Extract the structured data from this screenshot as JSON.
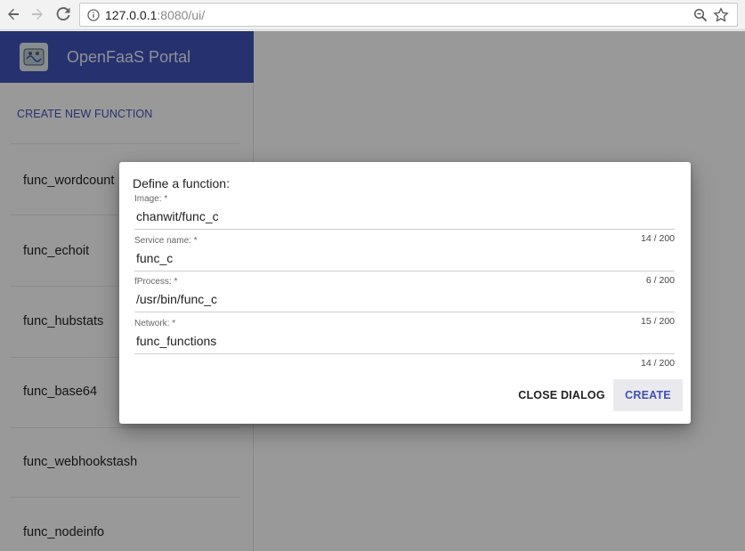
{
  "browser": {
    "url_host": "127.0.0.1",
    "url_rest": ":8080/ui/"
  },
  "sidebar": {
    "app_title": "OpenFaaS Portal",
    "create_label": "CREATE NEW FUNCTION",
    "functions": [
      "func_wordcount",
      "func_echoit",
      "func_hubstats",
      "func_base64",
      "func_webhookstash",
      "func_nodeinfo"
    ]
  },
  "dialog": {
    "title": "Define a function:",
    "fields": [
      {
        "label": "Image: *",
        "value": "chanwit/func_c",
        "counter": "14 / 200"
      },
      {
        "label": "Service name: *",
        "value": "func_c",
        "counter": "6 / 200"
      },
      {
        "label": "fProcess: *",
        "value": "/usr/bin/func_c",
        "counter": "15 / 200"
      },
      {
        "label": "Network: *",
        "value": "func_functions",
        "counter": "14 / 200"
      }
    ],
    "close_label": "CLOSE DIALOG",
    "create_label": "CREATE"
  },
  "colors": {
    "primary": "#3f51b5",
    "backdrop": "rgba(0,0,0,0.39)"
  },
  "icons": [
    "back-arrow-icon",
    "forward-arrow-icon",
    "reload-icon",
    "info-icon",
    "zoom-icon",
    "star-icon",
    "openfaas-logo-icon"
  ]
}
